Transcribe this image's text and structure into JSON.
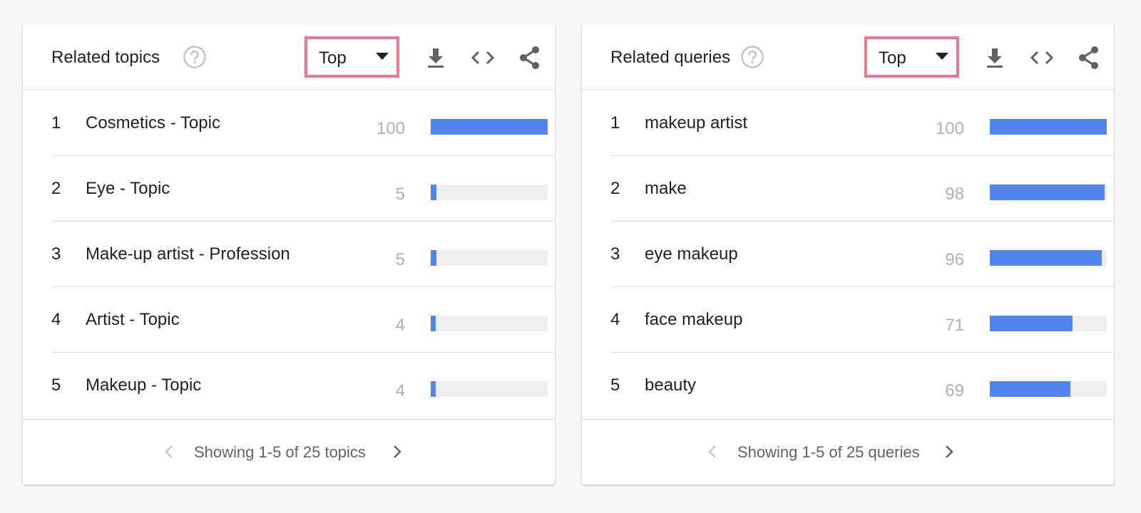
{
  "colors": {
    "bar_fill": "#5285ec",
    "bar_track": "#eeeeee",
    "highlight_border": "#f4758f",
    "value_text": "#b0b0b0"
  },
  "icons": {
    "help": "help-circle-icon",
    "download": "download-icon",
    "embed": "code-brackets-icon",
    "share": "share-icon",
    "prev": "chevron-left-icon",
    "next": "chevron-right-icon"
  },
  "panels": [
    {
      "title": "Related topics",
      "dropdown": {
        "selected": "Top"
      },
      "rows": [
        {
          "rank": "1",
          "label": "Cosmetics - Topic",
          "value": "100",
          "fill": 100
        },
        {
          "rank": "2",
          "label": "Eye - Topic",
          "value": "5",
          "fill": 5
        },
        {
          "rank": "3",
          "label": "Make-up artist - Profession",
          "value": "5",
          "fill": 5
        },
        {
          "rank": "4",
          "label": "Artist - Topic",
          "value": "4",
          "fill": 4
        },
        {
          "rank": "5",
          "label": "Makeup - Topic",
          "value": "4",
          "fill": 4
        }
      ],
      "pager": {
        "text": "Showing 1-5 of 25 topics"
      }
    },
    {
      "title": "Related queries",
      "dropdown": {
        "selected": "Top"
      },
      "rows": [
        {
          "rank": "1",
          "label": "makeup artist",
          "value": "100",
          "fill": 100
        },
        {
          "rank": "2",
          "label": "make",
          "value": "98",
          "fill": 98
        },
        {
          "rank": "3",
          "label": "eye makeup",
          "value": "96",
          "fill": 96
        },
        {
          "rank": "4",
          "label": "face makeup",
          "value": "71",
          "fill": 71
        },
        {
          "rank": "5",
          "label": "beauty",
          "value": "69",
          "fill": 69
        }
      ],
      "pager": {
        "text": "Showing 1-5 of 25 queries"
      }
    }
  ]
}
